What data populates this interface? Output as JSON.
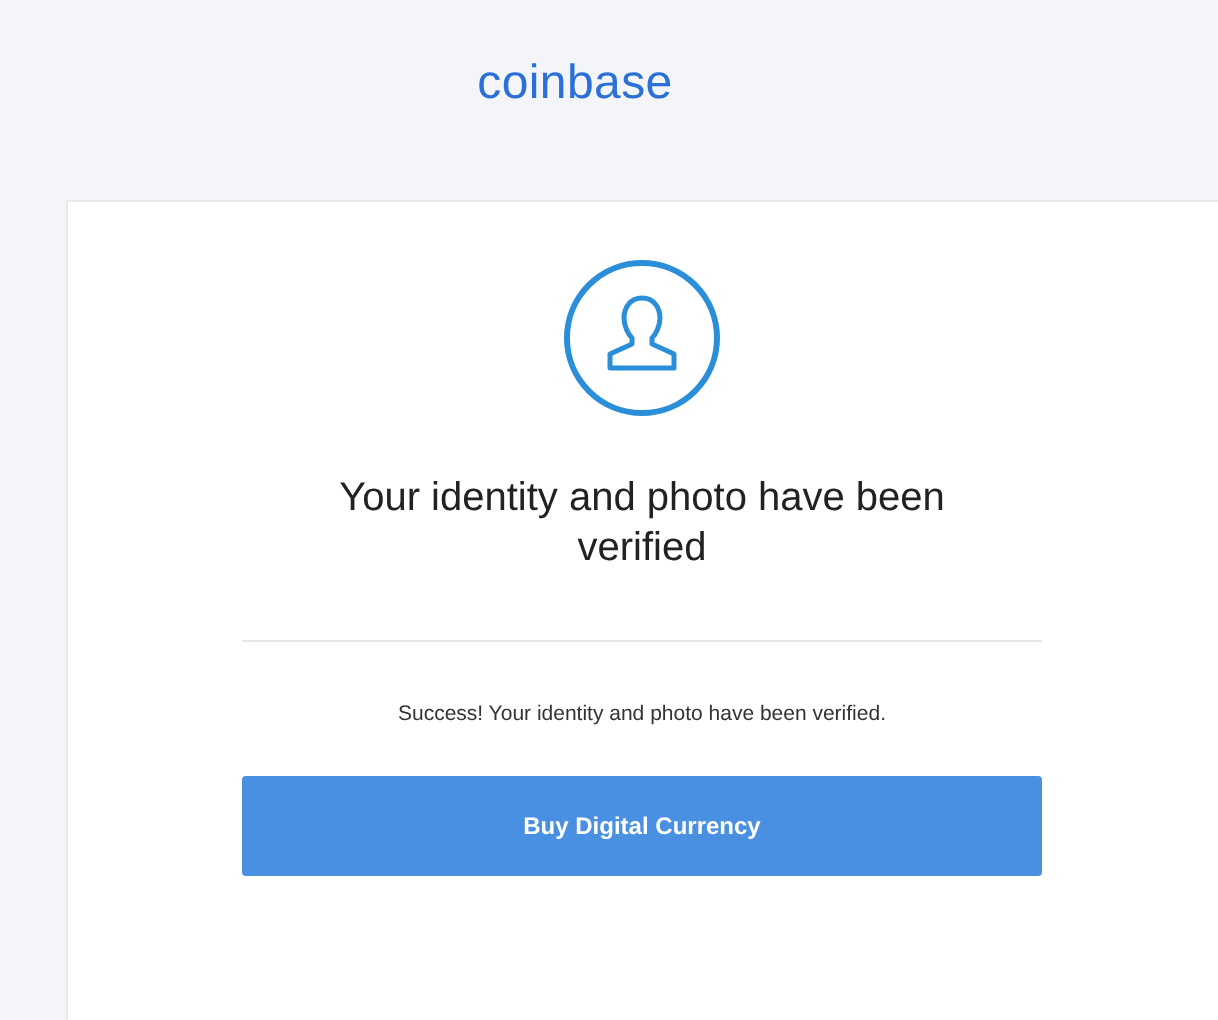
{
  "header": {
    "logo": "coinbase"
  },
  "card": {
    "title": "Your identity and photo have been verified",
    "message": "Success! Your identity and photo have been verified.",
    "button": "Buy Digital Currency"
  }
}
